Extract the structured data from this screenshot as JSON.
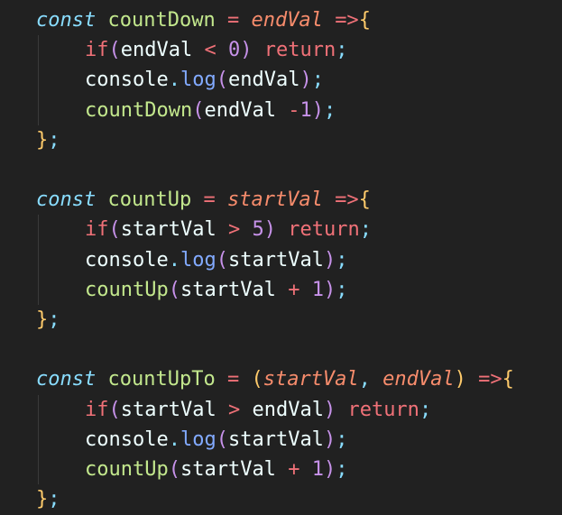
{
  "editor": {
    "lines": [
      {
        "indent": 0,
        "tokens": [
          [
            "const",
            "kw"
          ],
          [
            " ",
            "plain"
          ],
          [
            "countDown",
            "fn"
          ],
          [
            " ",
            "plain"
          ],
          [
            "=",
            "op"
          ],
          [
            " ",
            "plain"
          ],
          [
            "endVal",
            "param"
          ],
          [
            " ",
            "plain"
          ],
          [
            "=>",
            "arrow"
          ],
          [
            "{",
            "punc"
          ]
        ]
      },
      {
        "indent": 1,
        "tokens": [
          [
            "if",
            "if"
          ],
          [
            "(",
            "paren"
          ],
          [
            "endVal",
            "var"
          ],
          [
            " ",
            "plain"
          ],
          [
            "<",
            "op"
          ],
          [
            " ",
            "plain"
          ],
          [
            "0",
            "num"
          ],
          [
            ")",
            "paren"
          ],
          [
            " ",
            "plain"
          ],
          [
            "return",
            "ret"
          ],
          [
            ";",
            "semi"
          ]
        ]
      },
      {
        "indent": 1,
        "tokens": [
          [
            "console",
            "var"
          ],
          [
            ".",
            "dot"
          ],
          [
            "log",
            "method"
          ],
          [
            "(",
            "paren"
          ],
          [
            "endVal",
            "var"
          ],
          [
            ")",
            "paren"
          ],
          [
            ";",
            "semi"
          ]
        ]
      },
      {
        "indent": 1,
        "tokens": [
          [
            "countDown",
            "fn"
          ],
          [
            "(",
            "paren"
          ],
          [
            "endVal",
            "var"
          ],
          [
            " ",
            "plain"
          ],
          [
            "-",
            "op"
          ],
          [
            "1",
            "num"
          ],
          [
            ")",
            "paren"
          ],
          [
            ";",
            "semi"
          ]
        ]
      },
      {
        "indent": 0,
        "tokens": [
          [
            "}",
            "punc"
          ],
          [
            ";",
            "semi"
          ]
        ]
      },
      {
        "indent": 0,
        "tokens": []
      },
      {
        "indent": 0,
        "tokens": [
          [
            "const",
            "kw"
          ],
          [
            " ",
            "plain"
          ],
          [
            "countUp",
            "fn"
          ],
          [
            " ",
            "plain"
          ],
          [
            "=",
            "op"
          ],
          [
            " ",
            "plain"
          ],
          [
            "startVal",
            "param"
          ],
          [
            " ",
            "plain"
          ],
          [
            "=>",
            "arrow"
          ],
          [
            "{",
            "punc"
          ]
        ]
      },
      {
        "indent": 1,
        "tokens": [
          [
            "if",
            "if"
          ],
          [
            "(",
            "paren"
          ],
          [
            "startVal",
            "var"
          ],
          [
            " ",
            "plain"
          ],
          [
            ">",
            "op"
          ],
          [
            " ",
            "plain"
          ],
          [
            "5",
            "num"
          ],
          [
            ")",
            "paren"
          ],
          [
            " ",
            "plain"
          ],
          [
            "return",
            "ret"
          ],
          [
            ";",
            "semi"
          ]
        ]
      },
      {
        "indent": 1,
        "tokens": [
          [
            "console",
            "var"
          ],
          [
            ".",
            "dot"
          ],
          [
            "log",
            "method"
          ],
          [
            "(",
            "paren"
          ],
          [
            "startVal",
            "var"
          ],
          [
            ")",
            "paren"
          ],
          [
            ";",
            "semi"
          ]
        ]
      },
      {
        "indent": 1,
        "tokens": [
          [
            "countUp",
            "fn"
          ],
          [
            "(",
            "paren"
          ],
          [
            "startVal",
            "var"
          ],
          [
            " ",
            "plain"
          ],
          [
            "+",
            "op"
          ],
          [
            " ",
            "plain"
          ],
          [
            "1",
            "num"
          ],
          [
            ")",
            "paren"
          ],
          [
            ";",
            "semi"
          ]
        ]
      },
      {
        "indent": 0,
        "tokens": [
          [
            "}",
            "punc"
          ],
          [
            ";",
            "semi"
          ]
        ]
      },
      {
        "indent": 0,
        "tokens": []
      },
      {
        "indent": 0,
        "tokens": [
          [
            "const",
            "kw"
          ],
          [
            " ",
            "plain"
          ],
          [
            "countUpTo",
            "fn"
          ],
          [
            " ",
            "plain"
          ],
          [
            "=",
            "op"
          ],
          [
            " ",
            "plain"
          ],
          [
            "(",
            "punc"
          ],
          [
            "startVal",
            "param"
          ],
          [
            ",",
            "comma"
          ],
          [
            " ",
            "plain"
          ],
          [
            "endVal",
            "param"
          ],
          [
            ")",
            "punc"
          ],
          [
            " ",
            "plain"
          ],
          [
            "=>",
            "arrow"
          ],
          [
            "{",
            "punc"
          ]
        ]
      },
      {
        "indent": 1,
        "tokens": [
          [
            "if",
            "if"
          ],
          [
            "(",
            "paren"
          ],
          [
            "startVal",
            "var"
          ],
          [
            " ",
            "plain"
          ],
          [
            ">",
            "op"
          ],
          [
            " ",
            "plain"
          ],
          [
            "endVal",
            "var"
          ],
          [
            ")",
            "paren"
          ],
          [
            " ",
            "plain"
          ],
          [
            "return",
            "ret"
          ],
          [
            ";",
            "semi"
          ]
        ]
      },
      {
        "indent": 1,
        "tokens": [
          [
            "console",
            "var"
          ],
          [
            ".",
            "dot"
          ],
          [
            "log",
            "method"
          ],
          [
            "(",
            "paren"
          ],
          [
            "startVal",
            "var"
          ],
          [
            ")",
            "paren"
          ],
          [
            ";",
            "semi"
          ]
        ]
      },
      {
        "indent": 1,
        "tokens": [
          [
            "countUp",
            "fn"
          ],
          [
            "(",
            "paren"
          ],
          [
            "startVal",
            "var"
          ],
          [
            " ",
            "plain"
          ],
          [
            "+",
            "op"
          ],
          [
            " ",
            "plain"
          ],
          [
            "1",
            "num"
          ],
          [
            ")",
            "paren"
          ],
          [
            ";",
            "semi"
          ]
        ]
      },
      {
        "indent": 0,
        "tokens": [
          [
            "}",
            "punc"
          ],
          [
            ";",
            "semi"
          ]
        ]
      }
    ],
    "colors": {
      "background": "#212121",
      "keyword": "#89ddff",
      "function": "#c3e88d",
      "parameter": "#f78c6c",
      "operator": "#f07178",
      "brace": "#ffcb6b",
      "paren": "#c792ea",
      "method": "#82aaff",
      "text": "#eeffff"
    }
  }
}
